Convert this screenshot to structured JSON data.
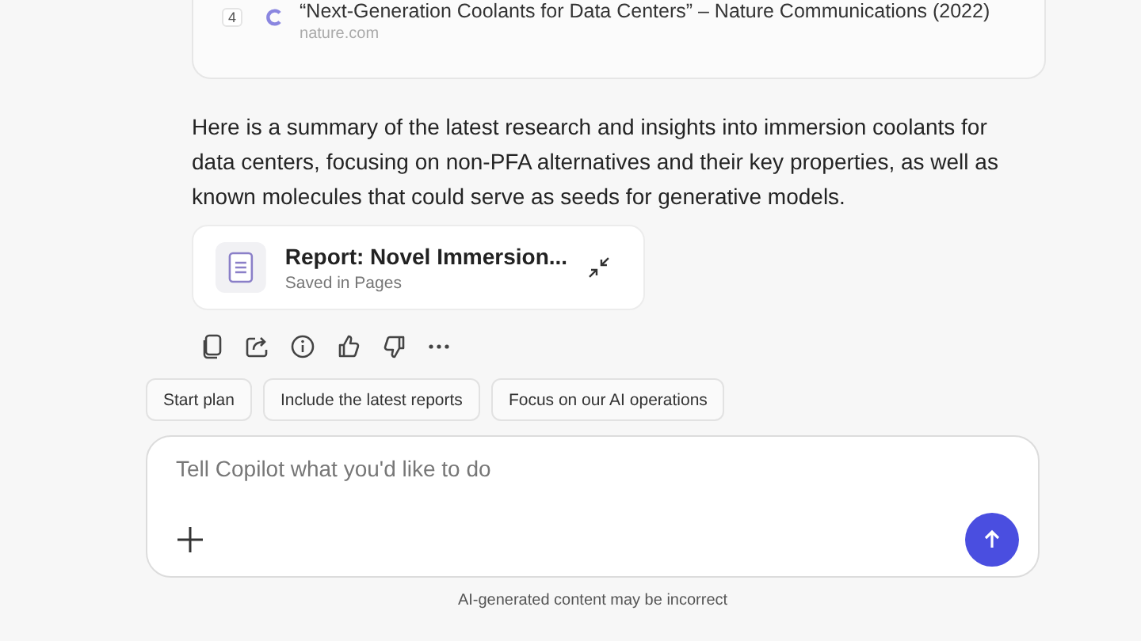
{
  "citation": {
    "number": "4",
    "title": "“Next-Generation Coolants for Data Centers” – Nature Communications (2022)",
    "source": "nature.com"
  },
  "summary": "Here is a summary of the latest research and insights into immersion coolants for data centers, focusing on non-PFA alternatives and their key properties, as well as known molecules that could serve as seeds for generative models.",
  "page_card": {
    "title": "Report: Novel Immersion...",
    "subtitle": "Saved in Pages"
  },
  "suggestions": [
    "Start plan",
    "Include the latest reports",
    "Focus on our AI operations"
  ],
  "composer": {
    "placeholder": "Tell Copilot what you'd like to do"
  },
  "disclaimer": "AI-generated content may be incorrect"
}
